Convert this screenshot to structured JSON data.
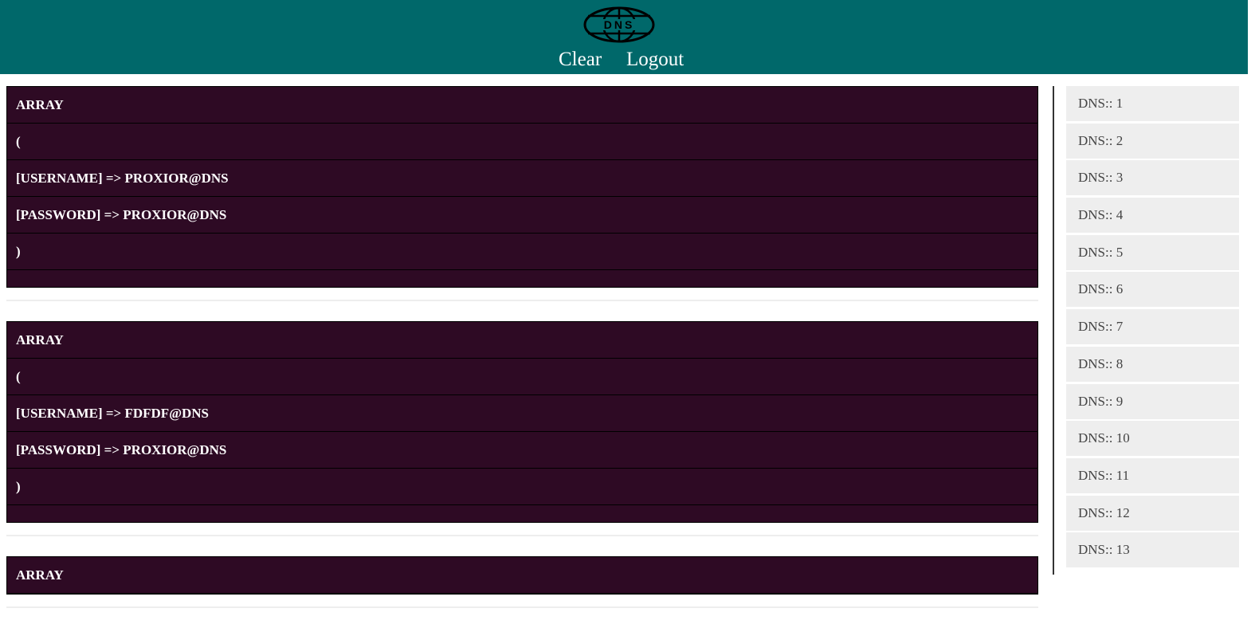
{
  "header": {
    "logo_text": "DNS",
    "nav": {
      "clear_label": "Clear",
      "logout_label": "Logout"
    }
  },
  "entries": [
    {
      "lines": [
        "ARRAY",
        "(",
        "[USERNAME] => PROXIOR@DNS",
        "[PASSWORD] => PROXIOR@DNS",
        ")"
      ]
    },
    {
      "lines": [
        "ARRAY",
        "(",
        "[USERNAME] => FDFDF@DNS",
        "[PASSWORD] => PROXIOR@DNS",
        ")"
      ]
    },
    {
      "lines": [
        "ARRAY"
      ]
    }
  ],
  "sidebar": {
    "items": [
      {
        "label": "DNS:: 1"
      },
      {
        "label": "DNS:: 2"
      },
      {
        "label": "DNS:: 3"
      },
      {
        "label": "DNS:: 4"
      },
      {
        "label": "DNS:: 5"
      },
      {
        "label": "DNS:: 6"
      },
      {
        "label": "DNS:: 7"
      },
      {
        "label": "DNS:: 8"
      },
      {
        "label": "DNS:: 9"
      },
      {
        "label": "DNS:: 10"
      },
      {
        "label": "DNS:: 11"
      },
      {
        "label": "DNS:: 12"
      },
      {
        "label": "DNS:: 13"
      }
    ]
  },
  "colors": {
    "header_bg": "#00686a",
    "entry_bg": "#2e0a24",
    "sidebar_item_bg": "#eeeeee"
  }
}
